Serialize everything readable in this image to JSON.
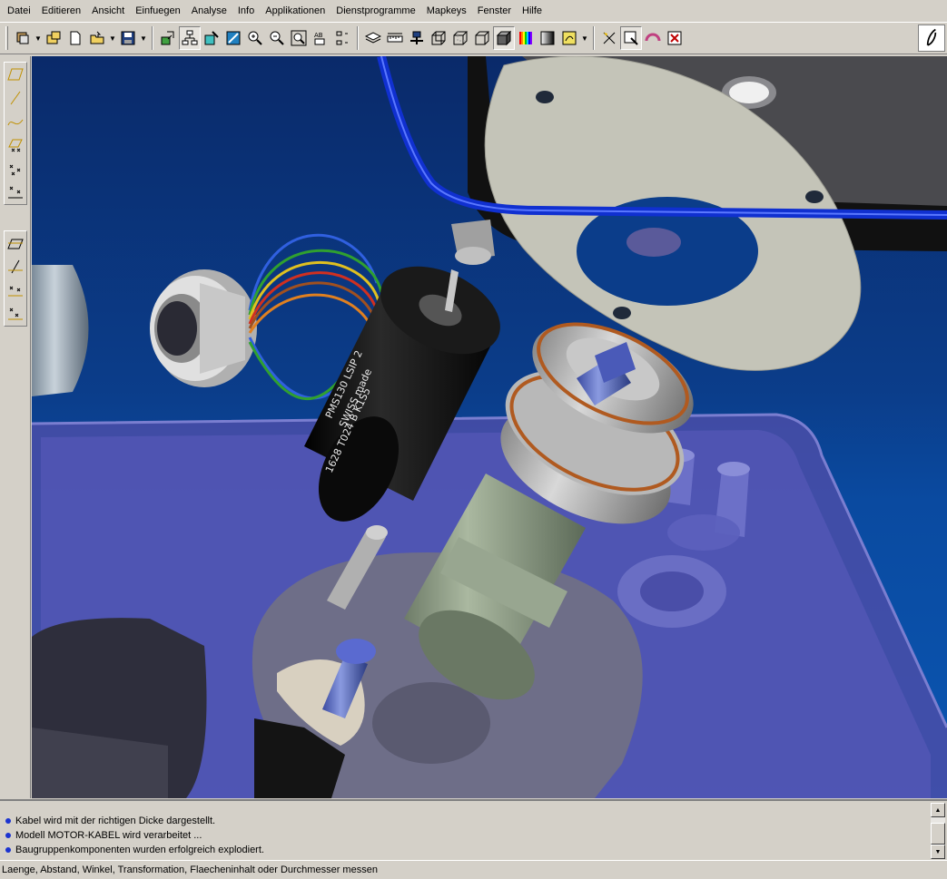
{
  "menu": [
    {
      "label": "Datei"
    },
    {
      "label": "Editieren"
    },
    {
      "label": "Ansicht"
    },
    {
      "label": "Einfuegen"
    },
    {
      "label": "Analyse"
    },
    {
      "label": "Info"
    },
    {
      "label": "Applikationen"
    },
    {
      "label": "Dienstprogramme"
    },
    {
      "label": "Mapkeys"
    },
    {
      "label": "Fenster"
    },
    {
      "label": "Hilfe"
    }
  ],
  "toolbar": {
    "icons": [
      "assembly-icon",
      "open-icon",
      "new-icon",
      "open-folder-icon",
      "save-icon",
      "regenerate-icon",
      "model-tree-icon",
      "repaint-icon",
      "orient-icon",
      "zoom-in-icon",
      "zoom-out-icon",
      "refit-icon",
      "annotation-icon",
      "datum-display-icon",
      "layers-icon",
      "measure-icon",
      "named-view-icon",
      "wireframe-icon",
      "hidden-line-icon",
      "no-hidden-icon",
      "shading-icon",
      "appearance-icon",
      "color-icon",
      "spin-icon",
      "select-icon",
      "query-icon",
      "pick-from-list-icon",
      "close-window-icon"
    ]
  },
  "model_text": {
    "motor_label_1": "PMS130 LSIP 2",
    "motor_label_2": "SWISS made",
    "motor_label_3": "1628 T024 B K1S5"
  },
  "messages": [
    {
      "text": "Kabel wird mit der richtigen Dicke dargestellt."
    },
    {
      "text": "Modell MOTOR-KABEL wird verarbeitet ..."
    },
    {
      "text": "Baugruppenkomponenten wurden erfolgreich explodiert."
    }
  ],
  "status": {
    "text": "Laenge, Abstand, Winkel, Transformation, Flaecheninhalt oder Durchmesser messen"
  },
  "colors": {
    "background_top": "#0a2a6a",
    "background_bottom": "#0a56b2",
    "cable": "#1030d0",
    "message_bullet": "#1b33d0"
  }
}
